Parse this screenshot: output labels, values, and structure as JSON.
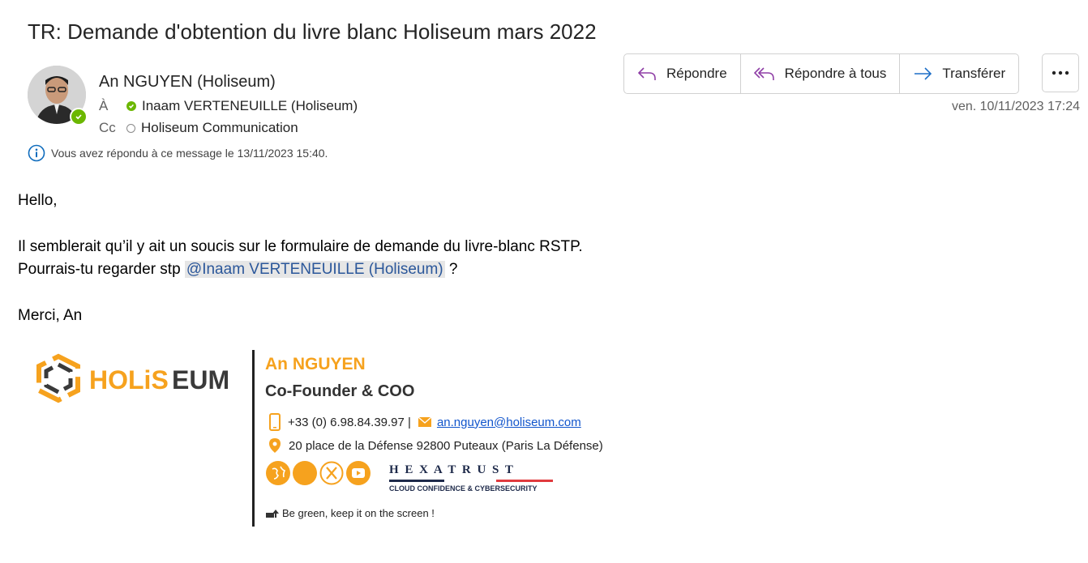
{
  "email": {
    "subject": "TR: Demande d'obtention du livre blanc Holiseum mars 2022",
    "sender": "An NGUYEN (Holiseum)",
    "to_label": "À",
    "to": "Inaam VERTENEUILLE (Holiseum)",
    "cc_label": "Cc",
    "cc": "Holiseum Communication",
    "info": "Vous avez répondu à ce message le 13/11/2023 15:40.",
    "date": "ven. 10/11/2023 17:24"
  },
  "actions": {
    "reply": "Répondre",
    "reply_all": "Répondre à tous",
    "forward": "Transférer"
  },
  "body": {
    "greeting": "Hello,",
    "line1": "Il semblerait qu’il y ait un soucis sur le formulaire de demande du livre-blanc RSTP.",
    "line2_prefix": "Pourrais-tu regarder stp ",
    "mention": "@Inaam VERTENEUILLE (Holiseum)",
    "line2_suffix": " ?",
    "closing": "Merci, An"
  },
  "signature": {
    "logo_text": "HOLiSEUM",
    "name": "An NGUYEN",
    "title": "Co-Founder & COO",
    "phone": "+33 (0) 6.98.84.39.97 |",
    "email": "an.nguyen@holiseum.com",
    "address": "20 place de la Défense 92800 Puteaux (Paris La Défense)",
    "hexatrust": "H E X A T R U S T",
    "hexatrust_sub": "CLOUD CONFIDENCE & CYBERSECURITY",
    "green": "Be green, keep it on the screen !"
  },
  "colors": {
    "accent": "#f6a21e",
    "presence": "#6bb700",
    "link": "#1155cc",
    "mention": "#2b579a"
  }
}
